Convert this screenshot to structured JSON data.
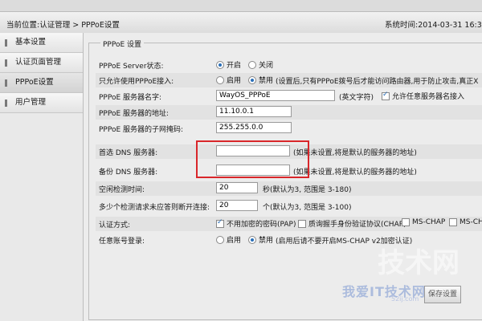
{
  "header": {
    "breadcrumb": "当前位置:认证管理 > PPPoE设置",
    "system_time": "系统时间:2014-03-31 16:3"
  },
  "sidebar": {
    "items": [
      {
        "label": "基本设置"
      },
      {
        "label": "认证页面管理"
      },
      {
        "label": "PPPoE设置"
      },
      {
        "label": "用户管理"
      }
    ]
  },
  "form": {
    "legend": "PPPoE 设置",
    "server_status": {
      "label": "PPPoE Server状态:",
      "on": "开启",
      "off": "关闭",
      "selected": "开启"
    },
    "pppoe_only": {
      "label": "只允许使用PPPoE接入:",
      "enable": "启用",
      "disable": "禁用",
      "selected": "禁用",
      "note": "(设置后,只有PPPoE拨号后才能访问路由器,用于防止攻击,真正X"
    },
    "server_name": {
      "label": "PPPoE 服务器名字:",
      "value": "WayOS_PPPoE",
      "hint": "(英文字符)",
      "allow_any_label": "允许任意服务器名接入",
      "allow_any_checked": true
    },
    "server_addr": {
      "label": "PPPoE 服务器的地址:",
      "value": "11.10.0.1"
    },
    "subnet": {
      "label": "PPPoE 服务器的子网掩码:",
      "value": "255.255.0.0"
    },
    "dns1": {
      "label": "首选 DNS 服务器:",
      "value": "",
      "note": "(如果未设置,将是默认的服务器的地址)"
    },
    "dns2": {
      "label": "备份 DNS 服务器:",
      "value": "",
      "note": "(如果未设置,将是默认的服务器的地址)"
    },
    "idle_time": {
      "label": "空闲检测时间:",
      "value": "20",
      "note": "秒(默认为3, 范围是 3-180)"
    },
    "no_reply": {
      "label": "多少个检测请求未应答则断开连接:",
      "value": "20",
      "note": "个(默认为3, 范围是 3-100)"
    },
    "auth": {
      "label": "认证方式:",
      "options": [
        {
          "label": "不用加密的密码(PAP)",
          "checked": true
        },
        {
          "label": "质询握手身份验证协议(CHAP)",
          "checked": false
        },
        {
          "label": "MS-CHAP",
          "checked": false
        },
        {
          "label": "MS-CHA",
          "checked": false
        }
      ]
    },
    "any_account": {
      "label": "任意账号登录:",
      "enable": "启用",
      "disable": "禁用",
      "selected": "禁用",
      "note": "(启用后请不要开启MS-CHAP v2加密认证)"
    }
  },
  "save_button": "保存设置",
  "watermark": {
    "logo": "我爱IT技术网",
    "url": "52ij.com",
    "graphic": "技术网"
  },
  "colors": {
    "highlight_box": "#d9262a",
    "radio_accent": "#2a6fb8"
  }
}
